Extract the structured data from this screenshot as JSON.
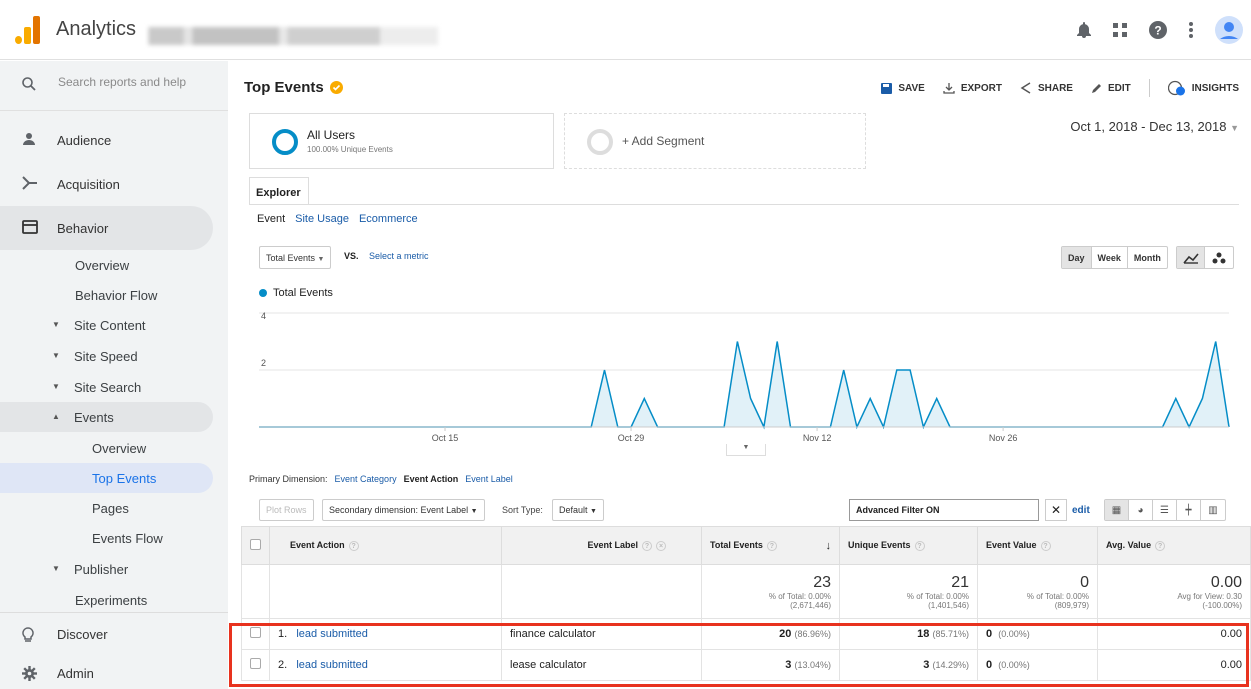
{
  "header": {
    "app_title": "Analytics",
    "icons": [
      "bell-icon",
      "apps-grid-icon",
      "help-icon",
      "more-vert-icon",
      "account-avatar-icon"
    ]
  },
  "sidebar": {
    "search_placeholder": "Search reports and help",
    "nav": [
      {
        "label": "Audience",
        "icon": "person-icon"
      },
      {
        "label": "Acquisition",
        "icon": "acquisition-icon"
      },
      {
        "label": "Behavior",
        "icon": "behavior-icon"
      }
    ],
    "behavior_sub": {
      "overview": "Overview",
      "behavior_flow": "Behavior Flow",
      "site_content": "Site Content",
      "site_speed": "Site Speed",
      "site_search": "Site Search",
      "events": "Events",
      "events_overview": "Overview",
      "top_events": "Top Events",
      "pages": "Pages",
      "events_flow": "Events Flow",
      "publisher": "Publisher",
      "experiments": "Experiments"
    },
    "discover": "Discover",
    "admin": "Admin"
  },
  "main": {
    "page_title": "Top Events",
    "toolbar": {
      "save": "SAVE",
      "export": "EXPORT",
      "share": "SHARE",
      "edit": "EDIT",
      "insights": "INSIGHTS"
    },
    "segment": {
      "name": "All Users",
      "sub": "100.00% Unique Events",
      "add": "+ Add Segment"
    },
    "date_range": "Oct 1, 2018 - Dec 13, 2018",
    "tab": "Explorer",
    "subtabs": {
      "event": "Event",
      "site_usage": "Site Usage",
      "ecommerce": "Ecommerce"
    },
    "metric": "Total Events",
    "vs": "VS.",
    "select_metric": "Select a metric",
    "periods": {
      "day": "Day",
      "week": "Week",
      "month": "Month"
    },
    "primary_dimension": {
      "label": "Primary Dimension:",
      "category": "Event Category",
      "action": "Event Action",
      "event_label": "Event Label"
    },
    "controls": {
      "plot_rows": "Plot Rows",
      "secondary": "Secondary dimension: Event Label",
      "sort_type": "Sort Type:",
      "sort_default": "Default",
      "advanced_filter": "Advanced Filter ON",
      "edit": "edit"
    }
  },
  "chart_data": {
    "type": "area",
    "title": "",
    "series": [
      {
        "name": "Total Events",
        "color": "#058dc7",
        "values": [
          0,
          0,
          0,
          0,
          0,
          0,
          0,
          0,
          0,
          0,
          0,
          0,
          0,
          0,
          0,
          0,
          0,
          0,
          0,
          0,
          0,
          0,
          0,
          0,
          0,
          0,
          2,
          0,
          0,
          1,
          0,
          0,
          0,
          0,
          0,
          0,
          3,
          1,
          0,
          3,
          0,
          0,
          0,
          0,
          2,
          0,
          1,
          0,
          2,
          2,
          0,
          1,
          0,
          0,
          0,
          0,
          0,
          0,
          0,
          0,
          0,
          0,
          0,
          0,
          0,
          0,
          0,
          0,
          0,
          1,
          0,
          1,
          3,
          0
        ]
      }
    ],
    "x_start": "2018-10-01",
    "x_ticks": [
      "Oct 15",
      "Oct 29",
      "Nov 12",
      "Nov 26"
    ],
    "y_ticks": [
      2,
      4
    ],
    "ylim": [
      0,
      4
    ],
    "grid": true
  },
  "table": {
    "headers": {
      "event_action": "Event Action",
      "event_label": "Event Label",
      "total_events": "Total Events",
      "unique_events": "Unique Events",
      "event_value": "Event Value",
      "avg_value": "Avg. Value"
    },
    "totals": {
      "total_events": "23",
      "total_events_sub1": "% of Total: 0.00%",
      "total_events_sub2": "(2,671,446)",
      "unique_events": "21",
      "unique_events_sub1": "% of Total: 0.00%",
      "unique_events_sub2": "(1,401,546)",
      "event_value": "0",
      "event_value_sub1": "% of Total: 0.00%",
      "event_value_sub2": "(809,979)",
      "avg_value": "0.00",
      "avg_value_sub1": "Avg for View: 0.30",
      "avg_value_sub2": "(-100.00%)"
    },
    "rows": [
      {
        "idx": "1.",
        "action": "lead submitted",
        "label": "finance calculator",
        "total": "20",
        "total_pct": "(86.96%)",
        "unique": "18",
        "unique_pct": "(85.71%)",
        "value": "0",
        "value_pct": "(0.00%)",
        "avg": "0.00"
      },
      {
        "idx": "2.",
        "action": "lead submitted",
        "label": "lease calculator",
        "total": "3",
        "total_pct": "(13.04%)",
        "unique": "3",
        "unique_pct": "(14.29%)",
        "value": "0",
        "value_pct": "(0.00%)",
        "avg": "0.00"
      }
    ]
  }
}
